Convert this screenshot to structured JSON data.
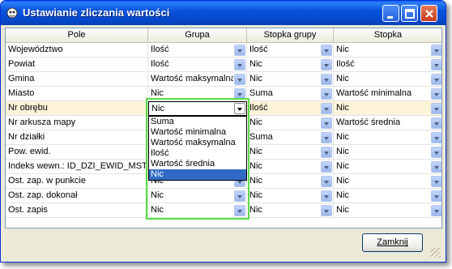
{
  "window": {
    "title": "Ustawianie zliczania wartości"
  },
  "grid": {
    "columns": [
      "Pole",
      "Grupa",
      "Stopka grupy",
      "Stopka"
    ],
    "rows": [
      {
        "pole": "Województwo",
        "grupa": "Ilość",
        "stopka_grupy": "Ilość",
        "stopka": "Nic"
      },
      {
        "pole": "Powiat",
        "grupa": "Ilość",
        "stopka_grupy": "Nic",
        "stopka": "Ilość"
      },
      {
        "pole": "Gmina",
        "grupa": "Wartość maksymalna",
        "stopka_grupy": "Nic",
        "stopka": "Nic"
      },
      {
        "pole": "Miasto",
        "grupa": "Nic",
        "stopka_grupy": "Suma",
        "stopka": "Wartość minimalna"
      },
      {
        "pole": "Nr obrębu",
        "grupa": "Nic",
        "stopka_grupy": "Ilość",
        "stopka": "Nic"
      },
      {
        "pole": "Nr arkusza mapy",
        "grupa": "",
        "stopka_grupy": "Nic",
        "stopka": "Wartość średnia"
      },
      {
        "pole": "Nr działki",
        "grupa": "",
        "stopka_grupy": "Suma",
        "stopka": "Nic"
      },
      {
        "pole": "Pow. ewid.",
        "grupa": "",
        "stopka_grupy": "Nic",
        "stopka": "Nic"
      },
      {
        "pole": "Indeks wewn.: ID_DZI_EWID_MSTP",
        "grupa": "",
        "stopka_grupy": "Nic",
        "stopka": "Nic"
      },
      {
        "pole": "Ost. zap. w punkcie",
        "grupa": "Nic",
        "stopka_grupy": "Nic",
        "stopka": "Nic"
      },
      {
        "pole": "Ost. zap. dokonał",
        "grupa": "Nic",
        "stopka_grupy": "Nic",
        "stopka": "Nic"
      },
      {
        "pole": "Ost. zapis",
        "grupa": "Nic",
        "stopka_grupy": "Nic",
        "stopka": "Nic"
      }
    ],
    "selected_row": 4,
    "open_dropdown": {
      "row": 4,
      "column": "Grupa",
      "value": "Nic",
      "options": [
        "Suma",
        "Wartość minimalna",
        "Wartość maksymalna",
        "Ilość",
        "Wartość średnia",
        "Nic"
      ],
      "highlighted": "Nic"
    }
  },
  "buttons": {
    "close_label": "Zamknij"
  },
  "colors": {
    "titlebar": "#0855dd",
    "highlight": "#316ac5",
    "callout": "#55dd44",
    "selected_row": "#fdf3d8"
  }
}
